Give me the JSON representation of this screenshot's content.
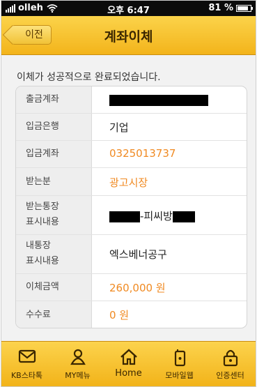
{
  "statusbar": {
    "carrier": "olleh",
    "time": "오후 6:47",
    "battery": "81 %",
    "battery_level": 0.81
  },
  "nav": {
    "back_label": "이전",
    "title": "계좌이체"
  },
  "message": "이체가 성공적으로 완료되었습니다.",
  "rows": [
    {
      "label": "출금계좌",
      "value": ""
    },
    {
      "label": "입금은행",
      "value": "기업"
    },
    {
      "label": "입금계좌",
      "value": "0325013737"
    },
    {
      "label": "받는분",
      "value": "광고시장"
    },
    {
      "label_line1": "받는통장",
      "label_line2": "표시내용",
      "value_visible": "-피씨방"
    },
    {
      "label_line1": "내통장",
      "label_line2": "표시내용",
      "value": "엑스베너공구"
    },
    {
      "label": "이체금액",
      "value": "260,000 원"
    },
    {
      "label": "수수료",
      "value": "0 원"
    }
  ],
  "colors": {
    "accent": "#f3b41b",
    "highlight_value": "#f08a22"
  },
  "tabs": [
    {
      "label": "KB스타톡",
      "icon": "envelope-icon"
    },
    {
      "label": "MY메뉴",
      "icon": "person-icon"
    },
    {
      "label": "Home",
      "icon": "home-icon"
    },
    {
      "label": "모바일웹",
      "icon": "phone-icon"
    },
    {
      "label": "인증센터",
      "icon": "lock-icon"
    }
  ]
}
